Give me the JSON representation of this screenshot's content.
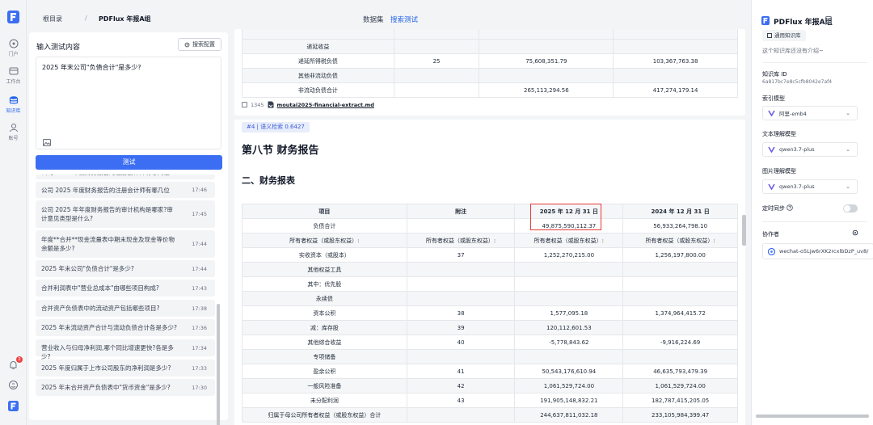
{
  "rail": {
    "items": [
      {
        "label": "门户",
        "icon": "portal-icon"
      },
      {
        "label": "工作台",
        "icon": "workbench-icon"
      },
      {
        "label": "知识库",
        "icon": "database-icon",
        "active": true
      },
      {
        "label": "账号",
        "icon": "user-icon"
      }
    ],
    "notification_count": "2"
  },
  "topbar": {
    "crumb_root": "根目录",
    "crumb_sep": "/",
    "crumb_current": "PDFlux 年报A组",
    "tab_dataset": "数据集",
    "tab_search": "搜索测试"
  },
  "left": {
    "title": "输入测试内容",
    "config_button": "搜索配置",
    "query": "2025 年末公司\"负债合计\"是多少?",
    "test_button": "测试",
    "history": [
      {
        "q": "公司 2025 年度财务报告的注册会计师有哪几位",
        "t": "17:46"
      },
      {
        "q": "公司 2025 年年度财务报告的审计机构是哪家?审计意见类型是什么?",
        "t": "17:45"
      },
      {
        "q": "年度**合并**现金流量表中期末现金及现金等价物余额是多少?",
        "t": "17:44"
      },
      {
        "q": "2025 年末公司\"负债合计\"是多少?",
        "t": "17:44"
      },
      {
        "q": "合并利润表中\"营业总成本\"由哪些项目构成?",
        "t": "17:43"
      },
      {
        "q": "合并资产负债表中的流动资产包括哪些项目?",
        "t": "17:38"
      },
      {
        "q": "2025 年末流动资产合计与流动负债合计各是多少?",
        "t": "17:36"
      },
      {
        "q": "营业收入与归母净利润,哪个同比增速更快?各是多少?",
        "t": "17:34"
      },
      {
        "q": "2025 年度归属于上市公司股东的净利润是多少?",
        "t": "17:33"
      },
      {
        "q": "2025 年末合并资产负债表中\"货币资金\"是多少?",
        "t": "17:30"
      }
    ]
  },
  "result1": {
    "rows": [
      [
        "递延收益",
        "",
        "",
        ""
      ],
      [
        "递延所得税负债",
        "25",
        "75,608,351.79",
        "103,367,763.38"
      ],
      [
        "其他非流动负债",
        "",
        "",
        ""
      ],
      [
        "非流动负债合计",
        "",
        "265,113,294.56",
        "417,274,179.14"
      ]
    ],
    "count": "1345",
    "file": "moutai2025-financial-extract.md"
  },
  "result2": {
    "tag": "#4 | 语义检索 0.6427",
    "h1": "第八节 财务报告",
    "h2": "二、财务报表",
    "header": [
      "项目",
      "附注",
      "2025 年 12 月 31 日",
      "2024 年 12 月 31 日"
    ],
    "rows": [
      [
        "负债合计",
        "",
        "49,875,590,112.37",
        "56,933,264,798.10"
      ],
      [
        "所有者权益（或股东权益）:",
        "所有者权益（或股东权益）:",
        "所有者权益（或股东权益）:",
        "所有者权益（或股东权益）:"
      ],
      [
        "实收资本（或股本）",
        "37",
        "1,252,270,215.00",
        "1,256,197,800.00"
      ],
      [
        "其他权益工具",
        "",
        "",
        ""
      ],
      [
        "其中：优先股",
        "",
        "",
        ""
      ],
      [
        "永续债",
        "",
        "",
        ""
      ],
      [
        "资本公积",
        "38",
        "1,577,095.18",
        "1,374,964,415.72"
      ],
      [
        "减：库存股",
        "39",
        "120,112,601.53",
        ""
      ],
      [
        "其他综合收益",
        "40",
        "-5,778,843.62",
        "-9,916,224.69"
      ],
      [
        "专项储备",
        "",
        "",
        ""
      ],
      [
        "盈余公积",
        "41",
        "50,543,176,610.94",
        "46,635,793,479.39"
      ],
      [
        "一般风险准备",
        "42",
        "1,061,529,724.00",
        "1,061,529,724.00"
      ],
      [
        "未分配利润",
        "43",
        "191,905,148,832.21",
        "182,787,415,205.05"
      ],
      [
        "归属于母公司所有者权益（或股东权益）合计",
        "",
        "244,637,811,032.18",
        "233,105,984,399.47"
      ]
    ]
  },
  "right": {
    "title": "PDFlux 年报A组",
    "chip": "通用知识库",
    "desc": "这个知识库还没有介绍~",
    "kb_id_label": "知识库 ID",
    "kb_id": "6a817bc7e8c5cfb8042e7af4",
    "index_model_label": "索引模型",
    "index_model": "阿里-emb4",
    "text_model_label": "文本理解模型",
    "text_model": "qwen3.7-plus",
    "image_model_label": "图片理解模型",
    "image_model": "qwen3.7-plus",
    "sync_label": "定时同步",
    "collab_label": "协作者",
    "collaborator": "wechat-o5Ljw6rXK2rcxlbDzP_uv8/"
  }
}
